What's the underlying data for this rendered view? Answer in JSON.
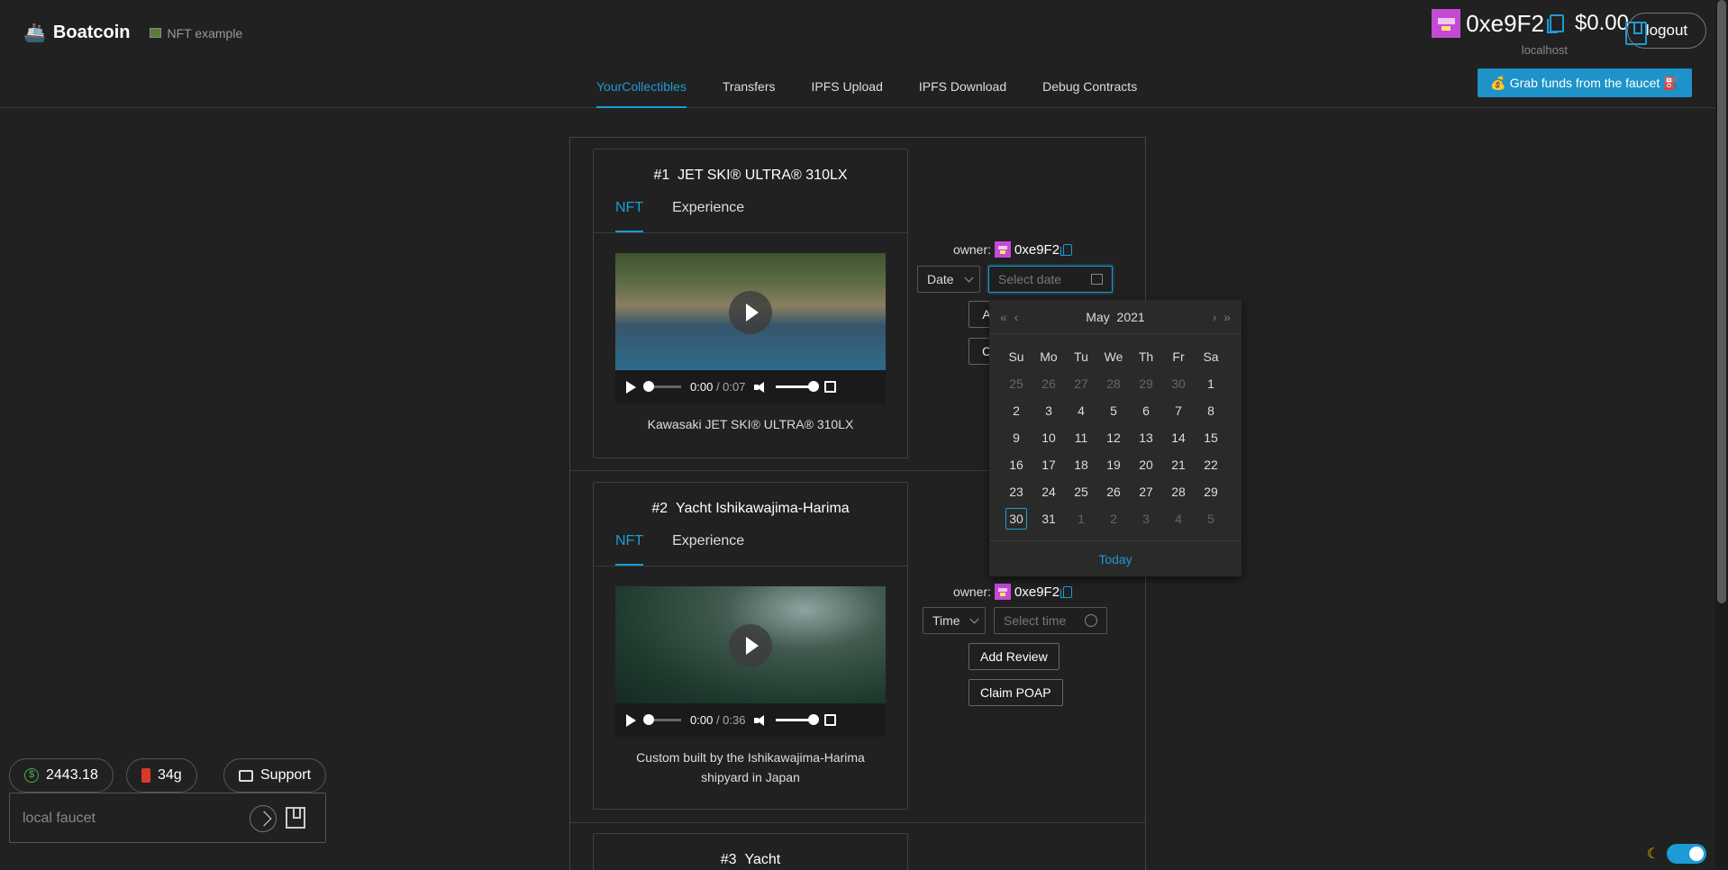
{
  "app": {
    "brand_icon": "boat-icon",
    "title": "Boatcoin",
    "subtitle": "NFT example"
  },
  "account": {
    "address": "0xe9F2",
    "balance": "$0.00",
    "network": "localhost",
    "logout_label": "logout",
    "faucet_button": "💰 Grab funds from the faucet ⛽"
  },
  "nav": {
    "tabs": [
      {
        "label": "YourCollectibles",
        "active": true
      },
      {
        "label": "Transfers"
      },
      {
        "label": "IPFS Upload"
      },
      {
        "label": "IPFS Download"
      },
      {
        "label": "Debug Contracts"
      }
    ]
  },
  "collectibles": [
    {
      "number": "#1",
      "name": "JET SKI® ULTRA® 310LX",
      "tabs": [
        "NFT",
        "Experience"
      ],
      "video": {
        "current": "0:00",
        "duration": "/ 0:07"
      },
      "caption": "Kawasaki JET SKI® ULTRA® 310LX",
      "owner_label": "owner:",
      "owner_address": "0xe9F2",
      "selector": "Date",
      "picker_placeholder": "Select date",
      "add_review": "Add Review",
      "claim_poap": "Claim POAP"
    },
    {
      "number": "#2",
      "name": "Yacht Ishikawajima-Harima",
      "tabs": [
        "NFT",
        "Experience"
      ],
      "video": {
        "current": "0:00",
        "duration": "/ 0:36"
      },
      "caption": "Custom built by the Ishikawajima-Harima shipyard in Japan",
      "owner_label": "owner:",
      "owner_address": "0xe9F2",
      "selector": "Time",
      "picker_placeholder": "Select time",
      "add_review": "Add Review",
      "claim_poap": "Claim POAP"
    },
    {
      "number": "#3",
      "name": "Yacht"
    }
  ],
  "calendar": {
    "month": "May",
    "year": "2021",
    "weekdays": [
      "Su",
      "Mo",
      "Tu",
      "We",
      "Th",
      "Fr",
      "Sa"
    ],
    "weeks": [
      [
        {
          "d": "25",
          "dim": true
        },
        {
          "d": "26",
          "dim": true
        },
        {
          "d": "27",
          "dim": true
        },
        {
          "d": "28",
          "dim": true
        },
        {
          "d": "29",
          "dim": true
        },
        {
          "d": "30",
          "dim": true
        },
        {
          "d": "1"
        }
      ],
      [
        {
          "d": "2"
        },
        {
          "d": "3"
        },
        {
          "d": "4"
        },
        {
          "d": "5"
        },
        {
          "d": "6"
        },
        {
          "d": "7"
        },
        {
          "d": "8"
        }
      ],
      [
        {
          "d": "9"
        },
        {
          "d": "10"
        },
        {
          "d": "11"
        },
        {
          "d": "12"
        },
        {
          "d": "13"
        },
        {
          "d": "14"
        },
        {
          "d": "15"
        }
      ],
      [
        {
          "d": "16"
        },
        {
          "d": "17"
        },
        {
          "d": "18"
        },
        {
          "d": "19"
        },
        {
          "d": "20"
        },
        {
          "d": "21"
        },
        {
          "d": "22"
        }
      ],
      [
        {
          "d": "23"
        },
        {
          "d": "24"
        },
        {
          "d": "25"
        },
        {
          "d": "26"
        },
        {
          "d": "27"
        },
        {
          "d": "28"
        },
        {
          "d": "29"
        }
      ],
      [
        {
          "d": "30",
          "selected": true
        },
        {
          "d": "31"
        },
        {
          "d": "1",
          "dim": true
        },
        {
          "d": "2",
          "dim": true
        },
        {
          "d": "3",
          "dim": true
        },
        {
          "d": "4",
          "dim": true
        },
        {
          "d": "5",
          "dim": true
        }
      ]
    ],
    "today_label": "Today"
  },
  "footer": {
    "eth_price": "2443.18",
    "gas": "34g",
    "support_label": "Support",
    "faucet_placeholder": "local faucet"
  },
  "colors": {
    "accent": "#1d9bd6",
    "background": "#212121"
  }
}
